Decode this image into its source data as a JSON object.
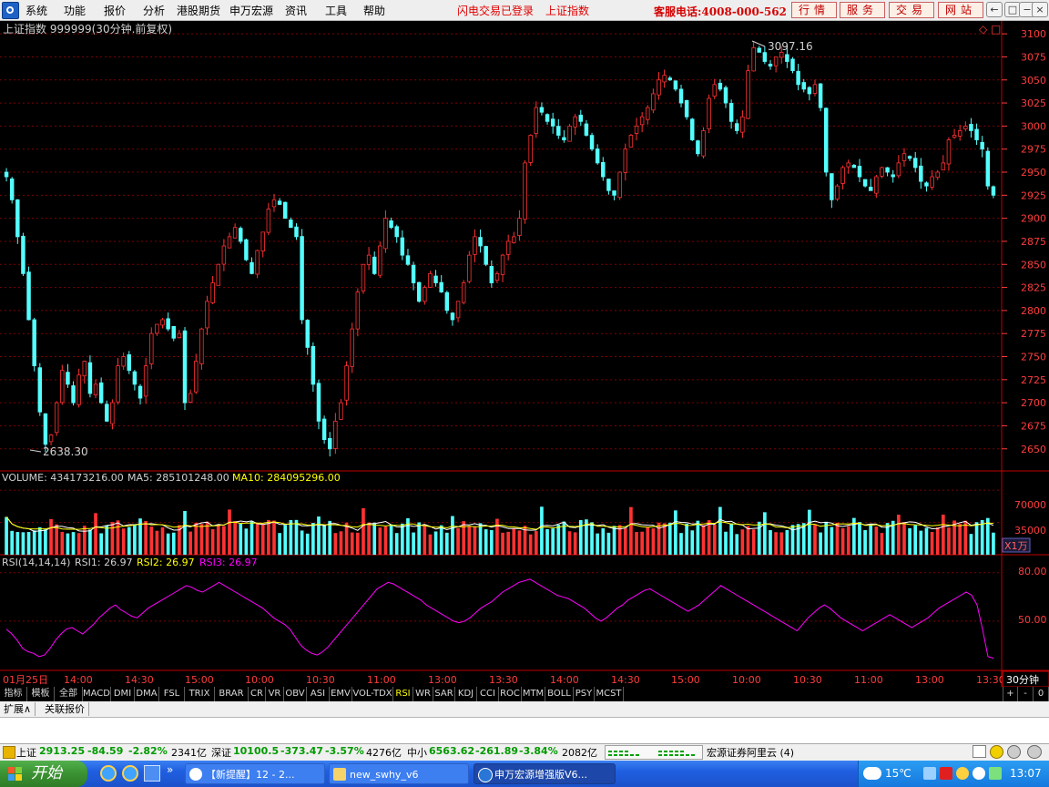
{
  "menu": {
    "items": [
      "系统",
      "功能",
      "报价",
      "分析",
      "港股期货",
      "申万宏源",
      "资讯",
      "工具",
      "帮助"
    ],
    "notice": "闪电交易已登录",
    "index_name": "上证指数",
    "hotline": "客服电话:4008-000-562",
    "right_buttons": [
      "行情",
      "服务",
      "交易",
      "网站"
    ],
    "window_buttons": [
      "←",
      "□",
      "−",
      "×"
    ]
  },
  "chart": {
    "title": "上证指数 999999(30分钟.前复权)",
    "corner_icons": [
      "◇",
      "□"
    ],
    "price_ticks": [
      "3100",
      "3075",
      "3050",
      "3025",
      "3000",
      "2975",
      "2950",
      "2925",
      "2900",
      "2875",
      "2850",
      "2825",
      "2800",
      "2775",
      "2750",
      "2725",
      "2700",
      "2675",
      "2650"
    ],
    "high_label": "3097.16",
    "low_label": "2638.30",
    "volume_label": "VOLUME: 434173216.00",
    "ma5_label": "MA5: 285101248.00",
    "ma10_label": "MA10: 284095296.00",
    "volume_ticks": [
      "70000",
      "35000"
    ],
    "volume_unit": "X1万",
    "rsi_label": "RSI(14,14,14)",
    "rsi1_label": "RSI1: 26.97",
    "rsi2_label": "RSI2: 26.97",
    "rsi3_label": "RSI3: 26.97",
    "rsi_ticks": [
      "80.00",
      "50.00"
    ],
    "time_labels": [
      "01月25日",
      "14:00",
      "14:30",
      "15:00",
      "10:00",
      "10:30",
      "11:00",
      "13:00",
      "13:30",
      "14:00",
      "14:30",
      "15:00",
      "10:00",
      "10:30",
      "11:00",
      "13:00",
      "13:30"
    ],
    "period": "30分钟"
  },
  "chart_data": {
    "type": "candlestick",
    "price_range": [
      2630,
      3110
    ],
    "high": 3097.16,
    "low": 2638.3,
    "volume_range": [
      0,
      85000
    ],
    "rsi_range": [
      20,
      90
    ],
    "closes": [
      2945,
      2920,
      2880,
      2840,
      2790,
      2740,
      2690,
      2655,
      2665,
      2700,
      2735,
      2720,
      2700,
      2730,
      2745,
      2710,
      2720,
      2700,
      2680,
      2700,
      2740,
      2750,
      2735,
      2720,
      2705,
      2740,
      2775,
      2785,
      2790,
      2780,
      2770,
      2775,
      2700,
      2710,
      2745,
      2780,
      2810,
      2830,
      2850,
      2870,
      2880,
      2890,
      2875,
      2855,
      2840,
      2865,
      2885,
      2910,
      2920,
      2915,
      2900,
      2890,
      2880,
      2790,
      2760,
      2720,
      2680,
      2660,
      2650,
      2680,
      2700,
      2740,
      2780,
      2820,
      2850,
      2860,
      2840,
      2870,
      2900,
      2890,
      2880,
      2860,
      2850,
      2830,
      2810,
      2825,
      2840,
      2830,
      2820,
      2800,
      2790,
      2810,
      2830,
      2860,
      2880,
      2870,
      2850,
      2830,
      2840,
      2860,
      2875,
      2880,
      2900,
      2960,
      2990,
      3020,
      3015,
      3005,
      3000,
      2990,
      2985,
      3000,
      3010,
      3005,
      2990,
      2975,
      2960,
      2945,
      2930,
      2925,
      2950,
      2975,
      2990,
      3000,
      3010,
      3020,
      3035,
      3050,
      3055,
      3050,
      3040,
      3025,
      3010,
      2985,
      2970,
      2995,
      3030,
      3045,
      3040,
      3025,
      3005,
      2995,
      3010,
      3060,
      3085,
      3080,
      3070,
      3065,
      3075,
      3080,
      3070,
      3060,
      3045,
      3040,
      3035,
      3045,
      3020,
      2950,
      2920,
      2935,
      2955,
      2960,
      2955,
      2945,
      2935,
      2930,
      2945,
      2955,
      2950,
      2945,
      2960,
      2970,
      2965,
      2955,
      2940,
      2935,
      2945,
      2950,
      2960,
      2985,
      2990,
      2995,
      3000,
      2995,
      2985,
      2975,
      2935,
      2925
    ],
    "rsi": [
      45,
      42,
      38,
      33,
      31,
      30,
      28,
      29,
      33,
      38,
      42,
      45,
      46,
      44,
      42,
      45,
      48,
      52,
      55,
      58,
      60,
      57,
      55,
      53,
      52,
      55,
      58,
      60,
      62,
      64,
      66,
      68,
      70,
      72,
      71,
      69,
      68,
      70,
      72,
      74,
      72,
      70,
      68,
      66,
      64,
      62,
      60,
      58,
      55,
      52,
      50,
      48,
      45,
      40,
      35,
      32,
      30,
      29,
      31,
      34,
      38,
      42,
      46,
      50,
      54,
      58,
      62,
      66,
      70,
      72,
      74,
      73,
      71,
      69,
      67,
      65,
      63,
      60,
      58,
      56,
      54,
      52,
      50,
      49,
      50,
      52,
      55,
      58,
      60,
      62,
      65,
      68,
      70,
      72,
      74,
      75,
      76,
      74,
      72,
      70,
      68,
      66,
      65,
      64,
      62,
      60,
      58,
      55,
      52,
      50,
      52,
      55,
      58,
      60,
      63,
      65,
      67,
      69,
      70,
      68,
      66,
      64,
      62,
      60,
      58,
      56,
      58,
      60,
      63,
      66,
      69,
      72,
      70,
      68,
      66,
      64,
      62,
      60,
      58,
      56,
      54,
      52,
      50,
      48,
      46,
      44,
      48,
      52,
      55,
      58,
      60,
      58,
      55,
      52,
      50,
      48,
      46,
      44,
      46,
      48,
      50,
      52,
      54,
      52,
      50,
      48,
      46,
      48,
      50,
      52,
      55,
      58,
      60,
      62,
      64,
      66,
      68,
      66,
      60,
      45,
      28,
      27
    ]
  },
  "tabs": {
    "items": [
      "指标",
      "模板",
      "全部",
      "MACD",
      "DMI",
      "DMA",
      "FSL",
      "TRIX",
      "BRAR",
      "CR",
      "VR",
      "OBV",
      "ASI",
      "EMV",
      "VOL-TDX",
      "RSI",
      "WR",
      "SAR",
      "KDJ",
      "CCI",
      "ROC",
      "MTM",
      "BOLL",
      "PSY",
      "MCST"
    ],
    "right_controls": [
      "+",
      "-",
      "0"
    ]
  },
  "expand_bar": {
    "items": [
      "扩展∧",
      "关联报价"
    ]
  },
  "status": {
    "sh_name": "上证",
    "sh_value": "2913.25",
    "sh_change": "-84.59",
    "sh_pct": "-2.82%",
    "sh_amount": "2341亿",
    "sz_name": "深证",
    "sz_value": "10100.5",
    "sz_change": "-373.47",
    "sz_pct": "-3.57%",
    "sz_amount": "4276亿",
    "zx_name": "中小",
    "zx_value": "6563.62",
    "zx_change": "-261.89",
    "zx_pct": "-3.84%",
    "zx_amount": "2082亿",
    "broker": "宏源证券阿里云 (4)"
  },
  "taskbar": {
    "start_label": "开始",
    "tasks": [
      "【新提醒】12 - 2...",
      "new_swhy_v6",
      "申万宏源增强版V6..."
    ],
    "weather": "15℃",
    "clock": "13:07"
  },
  "colors": {
    "up": "#ff3232",
    "down": "#54ffff",
    "rsi": "#ff00ff",
    "ma5": "#ffffff",
    "ma10": "#ffff00",
    "grid": "#800000",
    "axis_text": "#ff3c3c"
  }
}
